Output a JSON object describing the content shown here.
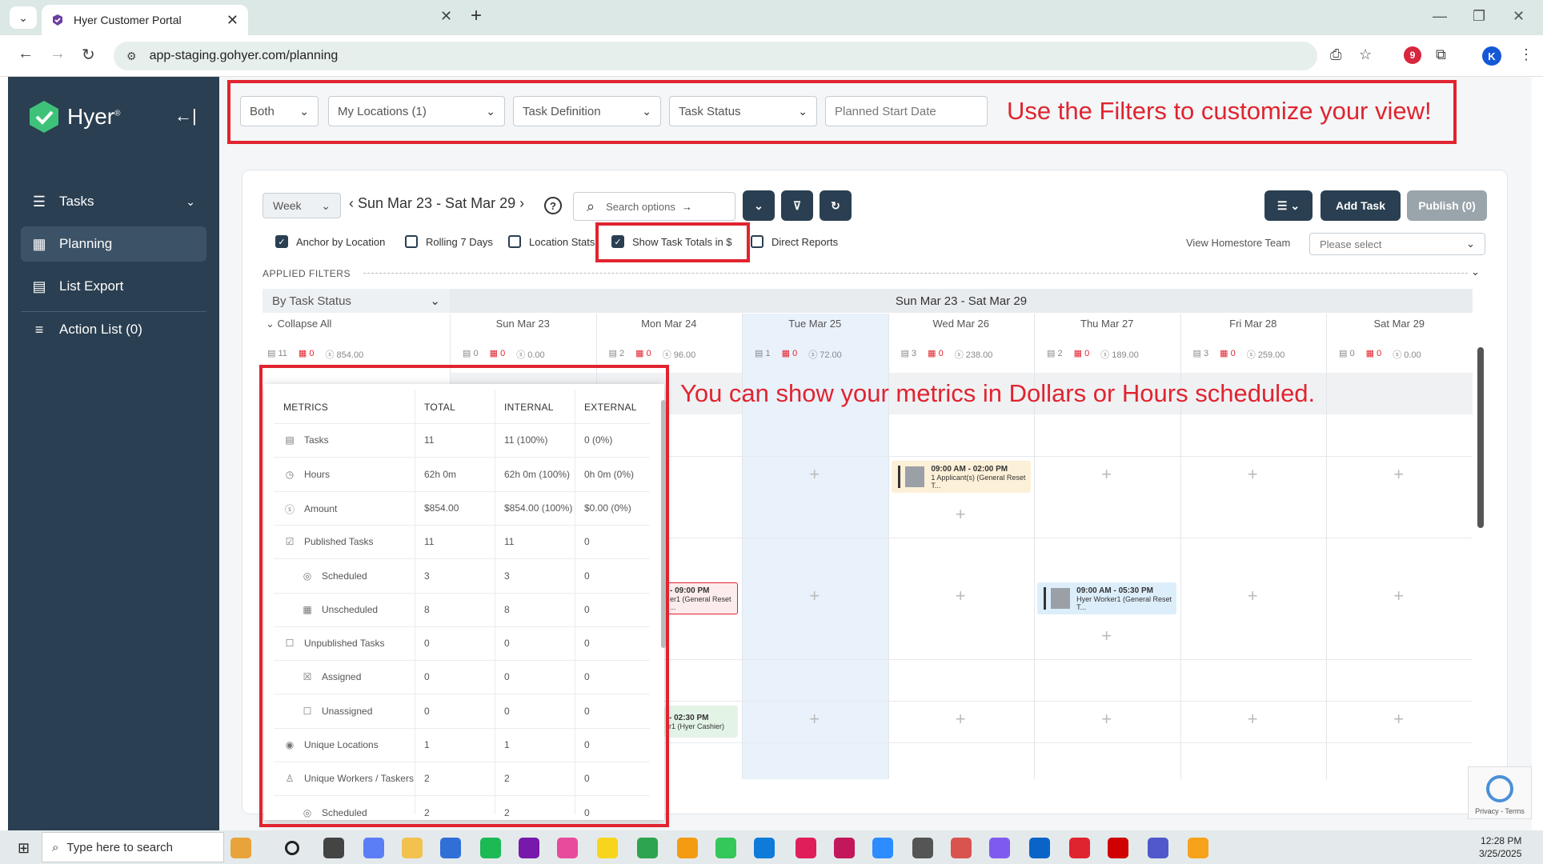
{
  "browser": {
    "tab_title": "Hyer Customer Portal",
    "url": "app-staging.gohyer.com/planning",
    "profile_initial": "K",
    "ext_badge": "9"
  },
  "sidebar": {
    "brand": "Hyer",
    "brand_mark": "®",
    "items": [
      {
        "label": "Tasks",
        "icon": "tasks-icon"
      },
      {
        "label": "Planning",
        "icon": "calendar-icon"
      },
      {
        "label": "List Export",
        "icon": "document-icon"
      },
      {
        "label": "Action List (0)",
        "icon": "list-icon"
      }
    ]
  },
  "filters": {
    "both": "Both",
    "locations": "My Locations (1)",
    "task_definition": "Task Definition",
    "task_status": "Task Status",
    "planned_start": "Planned Start Date"
  },
  "annotations": {
    "filters": "Use the Filters to customize your view!",
    "metrics": "You can show your metrics in Dollars or Hours scheduled."
  },
  "toolbar": {
    "week": "Week",
    "date_range": "Sun Mar 23 - Sat Mar 29",
    "help": "?",
    "search_placeholder": "Search options",
    "add_task": "Add Task",
    "publish": "Publish (0)"
  },
  "checkboxes": [
    {
      "label": "Anchor by Location",
      "checked": true
    },
    {
      "label": "Rolling 7 Days",
      "checked": false
    },
    {
      "label": "Location Stats",
      "checked": false
    },
    {
      "label": "Show Task Totals in $",
      "checked": true
    },
    {
      "label": "Direct Reports",
      "checked": false
    }
  ],
  "team": {
    "label": "View Homestore Team",
    "placeholder": "Please select"
  },
  "applied_filters": "APPLIED FILTERS",
  "grid": {
    "group_by": "By Task Status",
    "range": "Sun Mar 23 - Sat Mar 29",
    "collapse_all": "Collapse All",
    "summary": {
      "tasks": "11",
      "unscheduled": "0",
      "amount": "854.00"
    },
    "days": [
      {
        "label": "Sun Mar 23",
        "tasks": "0",
        "unscheduled": "0",
        "amount": "0.00"
      },
      {
        "label": "Mon Mar 24",
        "tasks": "2",
        "unscheduled": "0",
        "amount": "96.00"
      },
      {
        "label": "Tue Mar 25",
        "tasks": "1",
        "unscheduled": "0",
        "amount": "72.00"
      },
      {
        "label": "Wed Mar 26",
        "tasks": "3",
        "unscheduled": "0",
        "amount": "238.00"
      },
      {
        "label": "Thu Mar 27",
        "tasks": "2",
        "unscheduled": "0",
        "amount": "189.00"
      },
      {
        "label": "Fri Mar 28",
        "tasks": "3",
        "unscheduled": "0",
        "amount": "259.00"
      },
      {
        "label": "Sat Mar 29",
        "tasks": "0",
        "unscheduled": "0",
        "amount": "0.00"
      }
    ],
    "tasks": [
      {
        "time": "09:00 AM - 02:00 PM",
        "desc": "1 Applicant(s) (General Reset T..."
      },
      {
        "time": "09:00 AM - 05:30 PM",
        "desc": "Hyer Worker1 (General Reset T..."
      },
      {
        "time": "- 09:00 PM",
        "desc": "er1 (General Reset ..."
      },
      {
        "time": "- 02:30 PM",
        "desc": "r1 (Hyer Cashier)"
      }
    ]
  },
  "metrics": {
    "headers": [
      "METRICS",
      "TOTAL",
      "INTERNAL",
      "EXTERNAL"
    ],
    "rows": [
      {
        "name": "Tasks",
        "total": "11",
        "internal": "11 (100%)",
        "external": "0 (0%)",
        "indent": false
      },
      {
        "name": "Hours",
        "total": "62h 0m",
        "internal": "62h 0m (100%)",
        "external": "0h 0m (0%)",
        "indent": false
      },
      {
        "name": "Amount",
        "total": "$854.00",
        "internal": "$854.00 (100%)",
        "external": "$0.00 (0%)",
        "indent": false
      },
      {
        "name": "Published Tasks",
        "total": "11",
        "internal": "11",
        "external": "0",
        "indent": false
      },
      {
        "name": "Scheduled",
        "total": "3",
        "internal": "3",
        "external": "0",
        "indent": true
      },
      {
        "name": "Unscheduled",
        "total": "8",
        "internal": "8",
        "external": "0",
        "indent": true
      },
      {
        "name": "Unpublished Tasks",
        "total": "0",
        "internal": "0",
        "external": "0",
        "indent": false
      },
      {
        "name": "Assigned",
        "total": "0",
        "internal": "0",
        "external": "0",
        "indent": true
      },
      {
        "name": "Unassigned",
        "total": "0",
        "internal": "0",
        "external": "0",
        "indent": true
      },
      {
        "name": "Unique Locations",
        "total": "1",
        "internal": "1",
        "external": "0",
        "indent": false
      },
      {
        "name": "Unique Workers / Taskers",
        "total": "2",
        "internal": "2",
        "external": "0",
        "indent": false
      },
      {
        "name": "Scheduled",
        "total": "2",
        "internal": "2",
        "external": "0",
        "indent": true
      }
    ]
  },
  "recaptcha": "Privacy - Terms",
  "taskbar": {
    "search": "Type here to search",
    "time": "12:28 PM",
    "date": "3/25/2025"
  }
}
